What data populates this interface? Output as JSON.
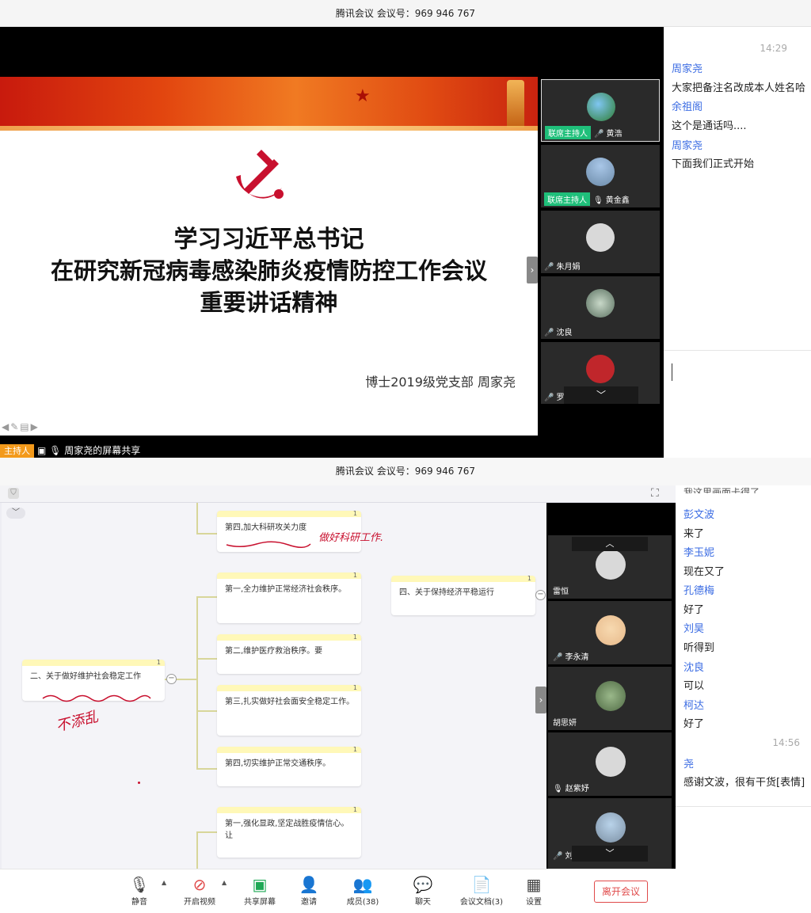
{
  "top": {
    "title": "腾讯会议 会议号：969 946 767",
    "slide": {
      "line1": "学习习近平总书记",
      "line2": "在研究新冠病毒感染肺炎疫情防控工作会议",
      "line3": "重要讲话精神",
      "author": "博士2019级党支部 周家尧"
    },
    "participants": [
      {
        "tag": "联席主持人",
        "name": "黄浩"
      },
      {
        "tag": "联席主持人",
        "name": "黄金鑫"
      },
      {
        "name": "朱月娟"
      },
      {
        "name": "沈良"
      },
      {
        "name": "罗欣凯"
      }
    ],
    "host_tag": "主持人",
    "share_label": "周家尧的屏幕共享",
    "chat": {
      "time": "14:29",
      "messages": [
        {
          "name": "周家尧",
          "text": "大家把备注名改成本人姓名哈"
        },
        {
          "name": "余祖阁",
          "text": "这个是通话吗...."
        },
        {
          "name": "周家尧",
          "text": "下面我们正式开始"
        }
      ]
    }
  },
  "bottom": {
    "title": "腾讯会议 会议号：969 946 767",
    "mindmap": {
      "node_count": "1",
      "nodes": {
        "n_top": "第四,加大科研攻关力度",
        "n_a1": "第一,全力维护正常经济社会秩序。",
        "n_a2": "第二,维护医疗救治秩序。要",
        "n_a3": "第三,扎实做好社会面安全稳定工作。",
        "n_a4": "第四,切实维护正常交通秩序。",
        "n_b1": "第一,强化显政,坚定战胜疫情信心。让",
        "n_main": "二、关于做好维护社会稳定工作",
        "n_right": "四、关于保持经济平稳运行"
      },
      "annot1": "做好科研工作.",
      "annot2": "不添乱"
    },
    "participants": [
      "雷恒",
      "李永清",
      "胡思妍",
      "赵紫妤",
      "刘晓明"
    ],
    "toolbar": {
      "mute": "静音",
      "video": "开启视频",
      "share": "共享屏幕",
      "invite": "邀请",
      "members": "成员(38)",
      "chat": "聊天",
      "docs": "会议文档(3)",
      "settings": "设置",
      "leave": "离开会议"
    },
    "chat": {
      "clipped_text": "我这里画面卡得了。",
      "time": "14:56",
      "messages": [
        {
          "name": "彭文波",
          "text": "来了"
        },
        {
          "name": "李玉妮",
          "text": "现在又了"
        },
        {
          "name": "孔德梅",
          "text": "好了"
        },
        {
          "name": "刘昊",
          "text": "听得到"
        },
        {
          "name": "沈良",
          "text": "可以"
        },
        {
          "name": "柯达",
          "text": "好了"
        },
        {
          "name": "尧",
          "text": "感谢文波，很有干货[表情]"
        }
      ]
    }
  }
}
